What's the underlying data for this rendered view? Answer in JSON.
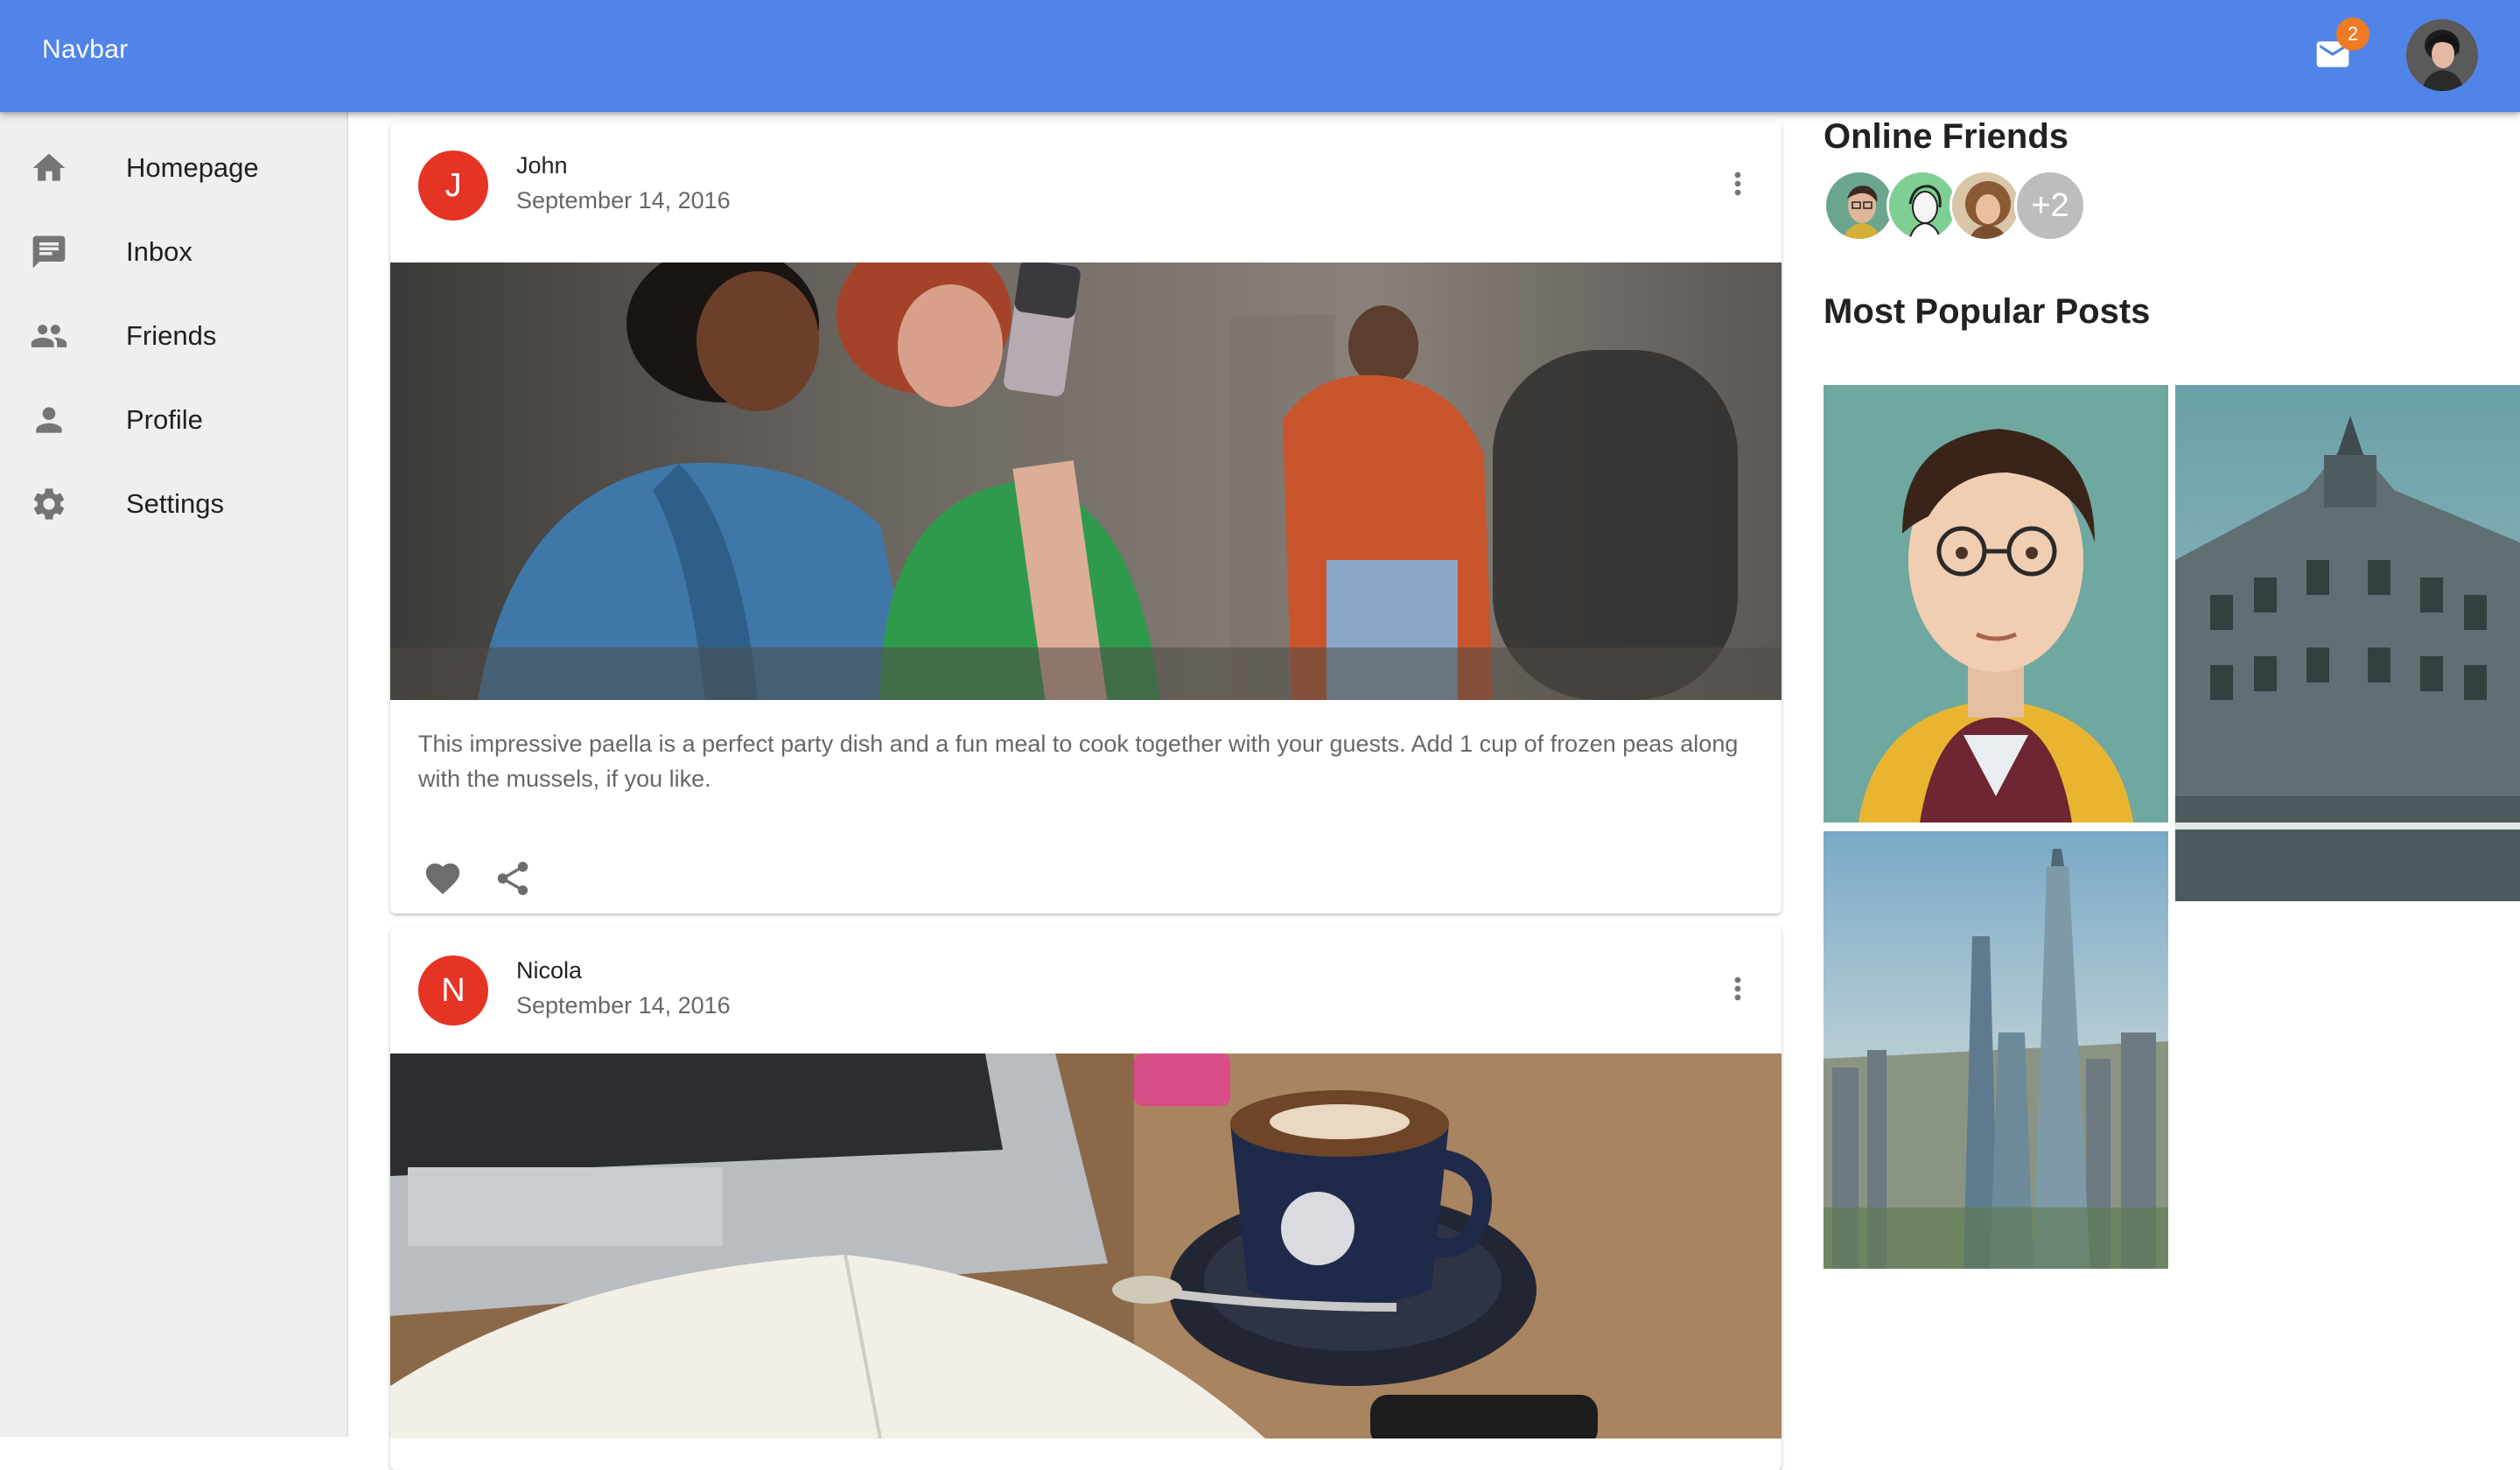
{
  "navbar": {
    "title": "Navbar",
    "mail_icon": "mail-icon",
    "notification_count": "2",
    "color": "#5184e8",
    "badge_color": "#f07b24"
  },
  "sidebar": {
    "items": [
      {
        "label": "Homepage",
        "icon": "home-icon"
      },
      {
        "label": "Inbox",
        "icon": "chat-icon"
      },
      {
        "label": "Friends",
        "icon": "people-icon"
      },
      {
        "label": "Profile",
        "icon": "person-icon"
      },
      {
        "label": "Settings",
        "icon": "gear-icon"
      }
    ]
  },
  "posts": [
    {
      "initial": "J",
      "author": "John",
      "date": "September 14, 2016",
      "text": "This impressive paella is a perfect party dish and a fun meal to cook together with your guests. Add 1 cup of frozen peas along with the mussels, if you like.",
      "actions": [
        "heart-icon",
        "share-icon"
      ]
    },
    {
      "initial": "N",
      "author": "Nicola",
      "date": "September 14, 2016"
    }
  ],
  "right": {
    "online_title": "Online Friends",
    "more_count": "+2",
    "popular_title": "Most Popular Posts"
  },
  "colors": {
    "avatar_red": "#e53324",
    "sidebar_bg": "#efeff0"
  }
}
